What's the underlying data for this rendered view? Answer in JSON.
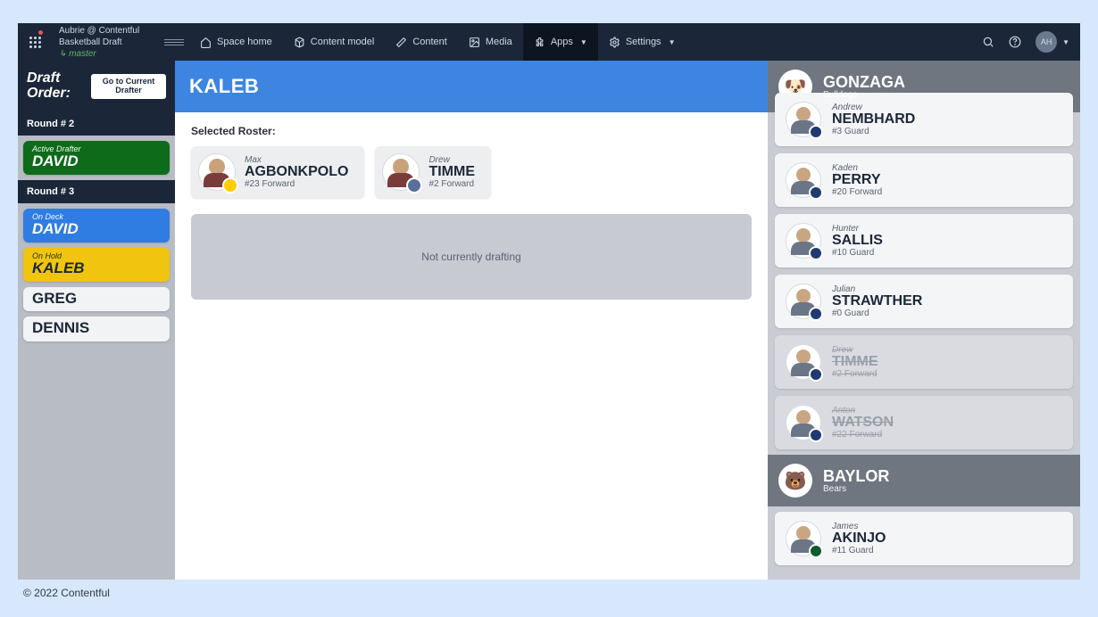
{
  "copyright": "© 2022 Contentful",
  "topnav": {
    "user_line": "Aubrie @ Contentful",
    "space": "Basketball Draft",
    "env": "master",
    "items": [
      {
        "label": "Space home"
      },
      {
        "label": "Content model"
      },
      {
        "label": "Content"
      },
      {
        "label": "Media"
      },
      {
        "label": "Apps"
      },
      {
        "label": "Settings"
      }
    ],
    "avatar": "AH"
  },
  "leftpanel": {
    "title": "Draft Order:",
    "goto": "Go to Current Drafter",
    "rounds": [
      {
        "label": "Round # 2",
        "drafters": [
          {
            "status": "Active Drafter",
            "name": "DAVID",
            "variant": "green"
          }
        ]
      },
      {
        "label": "Round # 3",
        "drafters": [
          {
            "status": "On Deck",
            "name": "DAVID",
            "variant": "blue"
          },
          {
            "status": "On Hold",
            "name": "KALEB",
            "variant": "yellow"
          },
          {
            "status": "",
            "name": "GREG",
            "variant": "white"
          },
          {
            "status": "",
            "name": "DENNIS",
            "variant": "white"
          }
        ]
      }
    ]
  },
  "center": {
    "title": "KALEB",
    "roster_label": "Selected Roster:",
    "players": [
      {
        "first": "Max",
        "last": "AGBONKPOLO",
        "pos": "#23 Forward",
        "badge": "#ffcc00"
      },
      {
        "first": "Drew",
        "last": "TIMME",
        "pos": "#2 Forward",
        "badge": "#5b6f9c"
      }
    ],
    "empty_msg": "Not currently drafting"
  },
  "rightpanel": {
    "teams": [
      {
        "name": "GONZAGA",
        "subtitle": "Bulldogs",
        "logo_bg": "#1f3b70",
        "logo_emoji": "🐶",
        "players": [
          {
            "first": "Andrew",
            "last": "NEMBHARD",
            "pos": "#3 Guard",
            "disabled": false
          },
          {
            "first": "Kaden",
            "last": "PERRY",
            "pos": "#20 Forward",
            "disabled": false
          },
          {
            "first": "Hunter",
            "last": "SALLIS",
            "pos": "#10 Guard",
            "disabled": false
          },
          {
            "first": "Julian",
            "last": "STRAWTHER",
            "pos": "#0 Guard",
            "disabled": false
          },
          {
            "first": "Drew",
            "last": "TIMME",
            "pos": "#2 Forward",
            "disabled": true
          },
          {
            "first": "Anton",
            "last": "WATSON",
            "pos": "#22 Forward",
            "disabled": true
          }
        ]
      },
      {
        "name": "BAYLOR",
        "subtitle": "Bears",
        "logo_bg": "#0d5c2a",
        "logo_emoji": "🐻",
        "players": [
          {
            "first": "James",
            "last": "AKINJO",
            "pos": "#11 Guard",
            "disabled": false
          }
        ]
      }
    ]
  }
}
